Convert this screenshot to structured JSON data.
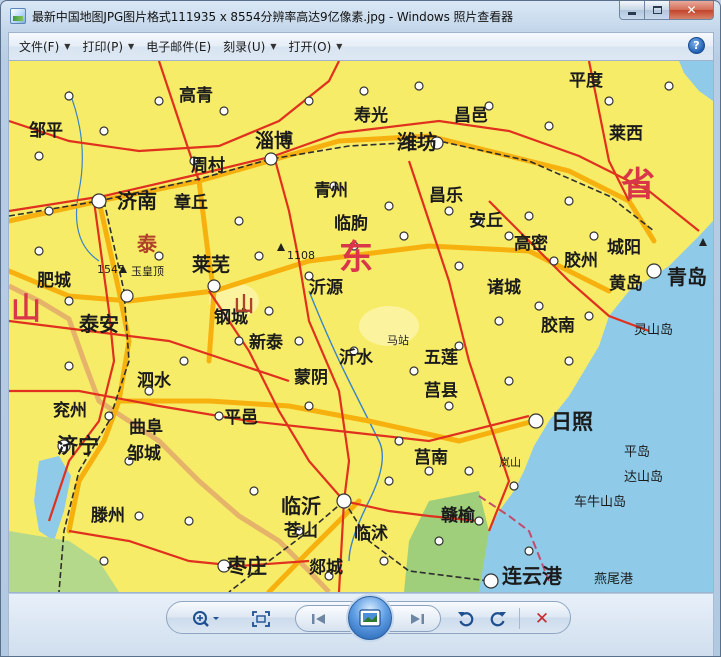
{
  "window": {
    "title": "最新中国地图JPG图片格式111935 x 8554分辨率高达9亿像素.jpg - Windows 照片查看器",
    "close_glyph": "✕"
  },
  "menu": {
    "items": [
      {
        "label": "文件(F)",
        "arrow": "▼"
      },
      {
        "label": "打印(P)",
        "arrow": "▼"
      },
      {
        "label": "电子邮件(E)",
        "arrow": ""
      },
      {
        "label": "刻录(U)",
        "arrow": "▼"
      },
      {
        "label": "打开(O)",
        "arrow": "▼"
      }
    ],
    "help": "?"
  },
  "map": {
    "labels": {
      "jinan": "济南",
      "zhangqiu": "章丘",
      "zibo": "淄博",
      "weifang": "潍坊",
      "zhoucun": "周村",
      "qingzhou": "青州",
      "linqu": "临朐",
      "changle": "昌乐",
      "anqiu": "安丘",
      "gaomi": "高密",
      "jiaozhou": "胶州",
      "chengyang": "城阳",
      "qingdao": "青岛",
      "huangdao": "黄岛",
      "laiwu": "莱芜",
      "taian": "泰安",
      "feicheng": "肥城",
      "xintai": "新泰",
      "gangcheng": "钢城",
      "yiyuan": "沂源",
      "mengyin": "蒙阴",
      "yishui": "沂水",
      "juxian": "莒县",
      "wulian": "五莲",
      "zhucheng": "诸城",
      "jiaonan": "胶南",
      "rizhao": "日照",
      "linyi": "临沂",
      "pingyi": "平邑",
      "sishui": "泗水",
      "qufu": "曲阜",
      "yanzhou": "兖州",
      "jining": "济宁",
      "zoucheng": "邹城",
      "tengzhou": "滕州",
      "zaozhuang": "枣庄",
      "lianyungang": "连云港",
      "tancheng": "郯城",
      "cangshan": "苍山",
      "junan": "莒南",
      "linshu": "临沭",
      "ganyu": "赣榆",
      "pingdu": "平度",
      "zouping": "邹平",
      "shouguang": "寿光",
      "changyi": "昌邑",
      "laixi": "莱西",
      "gaoqing": "高青",
      "province_shan": "山",
      "province_dong": "东",
      "province_sheng": "省",
      "mt_tai": "泰",
      "mt_shan2": "山",
      "peak_1545": "1545",
      "peak_1108": "1108",
      "yuhuangding": "玉皇顶",
      "lingshan_dao": "灵山岛",
      "pingdao": "平岛",
      "dashan_dao": "达山岛",
      "cheniu_shandao": "车牛山岛",
      "yanwei_gang": "燕尾港",
      "lanshan": "岚山",
      "mapu": "马站"
    }
  },
  "toolbar": {
    "zoom": "zoom-icon",
    "fit": "actual-size-icon",
    "prev": "previous-icon",
    "slideshow": "slideshow-icon",
    "next": "next-icon",
    "rotate_left": "rotate-ccw-icon",
    "rotate_right": "rotate-cw-icon",
    "delete": "delete-icon",
    "delete_glyph": "✕"
  },
  "colors": {
    "land": "#f7ec68",
    "sea": "#8fcbe8",
    "mountain_green": "#9fcf7a",
    "road_red": "#e0301e",
    "road_yellow": "#f7b10f",
    "boundary": "#c24b6e",
    "rail": "#3a3a3a",
    "title_bar": "#c3d6ea"
  }
}
